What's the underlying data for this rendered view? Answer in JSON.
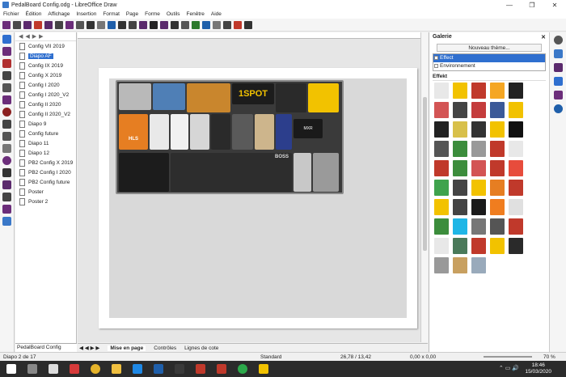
{
  "window": {
    "title": "PedalBoard Config.odg - LibreOffice Draw",
    "minimize": "—",
    "maximize": "❐",
    "close": "✕"
  },
  "menu": [
    "Fichier",
    "Édition",
    "Affichage",
    "Insertion",
    "Format",
    "Page",
    "Forme",
    "Outils",
    "Fenêtre",
    "Aide"
  ],
  "slides": {
    "nav": [
      "◀",
      "◀",
      "▶",
      "▶"
    ],
    "items": [
      "Config VII 2019",
      "Diapo AF",
      "Config IX 2019",
      "Config X 2019",
      "Config I 2020",
      "Config I 2020_V2",
      "Config II 2020",
      "Config II 2020_V2",
      "Diapo 9",
      "Config future",
      "Diapo 11",
      "Diapo 12",
      "PB2 Config X 2019",
      "PB2 Config I 2020",
      "PB2 Config future",
      "Poster",
      "Poster 2"
    ],
    "selected_index": 1,
    "doc_tab": "PedalBoard Config"
  },
  "canvas": {
    "pedalboard_text": "1SPOT",
    "pedal_labels": [
      "BOSS",
      "MXR",
      "HLS"
    ]
  },
  "bottom_tabs": {
    "nav": "◀ ◀ ▶ ▶",
    "tabs": [
      "Mise en page",
      "Contrôles",
      "Lignes de cote"
    ]
  },
  "gallery": {
    "title": "Galerie",
    "close": "✕",
    "new_theme": "Nouveau thème...",
    "themes": [
      "Effect",
      "Environnement"
    ],
    "selected_theme": "Effect",
    "current_group": "Effekt"
  },
  "status": {
    "slide": "Diapo 2 de 17",
    "layout": "Standard",
    "position": "26,78 / 13,42",
    "size": "0,00 x 0,00",
    "zoom": "70 %"
  },
  "taskbar": {
    "time": "18:46",
    "date": "15/03/2020"
  },
  "colors": {
    "accent": "#2f6fcf",
    "board": "#3a3a3a",
    "taskbar": "#2b2b2b"
  }
}
